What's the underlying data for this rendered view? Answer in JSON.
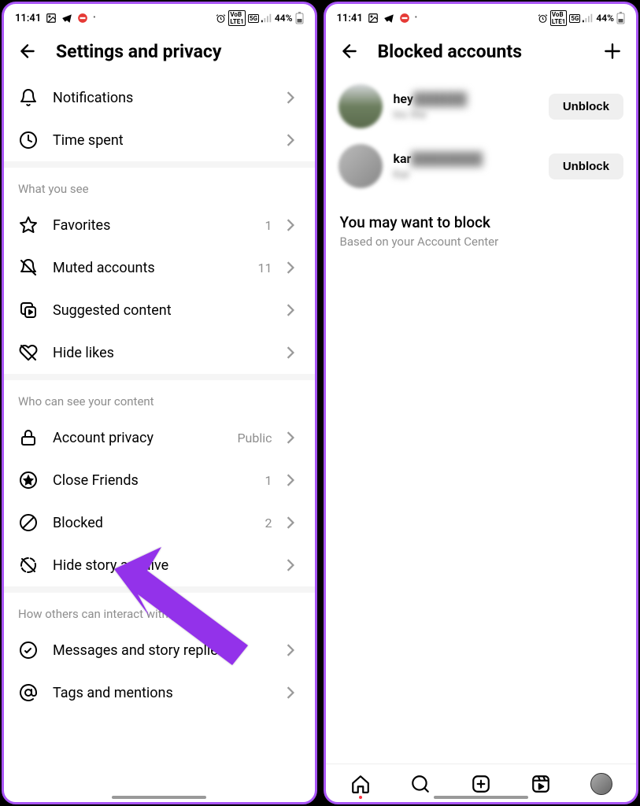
{
  "statusBar": {
    "time": "11:41",
    "batteryPct": "44%"
  },
  "left": {
    "title": "Settings and privacy",
    "topRows": [
      {
        "icon": "bell",
        "label": "Notifications"
      },
      {
        "icon": "clock",
        "label": "Time spent"
      }
    ],
    "sections": [
      {
        "header": "What you see",
        "rows": [
          {
            "icon": "star",
            "label": "Favorites",
            "value": "1"
          },
          {
            "icon": "bell-off",
            "label": "Muted accounts",
            "value": "11"
          },
          {
            "icon": "suggested",
            "label": "Suggested content",
            "value": ""
          },
          {
            "icon": "heart-off",
            "label": "Hide likes",
            "value": ""
          }
        ]
      },
      {
        "header": "Who can see your content",
        "rows": [
          {
            "icon": "lock",
            "label": "Account privacy",
            "value": "Public"
          },
          {
            "icon": "star-circle",
            "label": "Close Friends",
            "value": "1"
          },
          {
            "icon": "block",
            "label": "Blocked",
            "value": "2"
          },
          {
            "icon": "story-off",
            "label": "Hide story and live",
            "value": ""
          }
        ]
      },
      {
        "header": "How others can interact with you",
        "rows": [
          {
            "icon": "message",
            "label": "Messages and story replies",
            "value": ""
          },
          {
            "icon": "mention",
            "label": "Tags and mentions",
            "value": ""
          }
        ]
      }
    ]
  },
  "right": {
    "title": "Blocked accounts",
    "accounts": [
      {
        "name": "hey",
        "sub": "Inc the",
        "button": "Unblock"
      },
      {
        "name": "kar",
        "sub": "Kar",
        "button": "Unblock"
      }
    ],
    "suggestTitle": "You may want to block",
    "suggestSub": "Based on your Account Center"
  },
  "annotation": {
    "arrowColor": "#9333ea"
  }
}
